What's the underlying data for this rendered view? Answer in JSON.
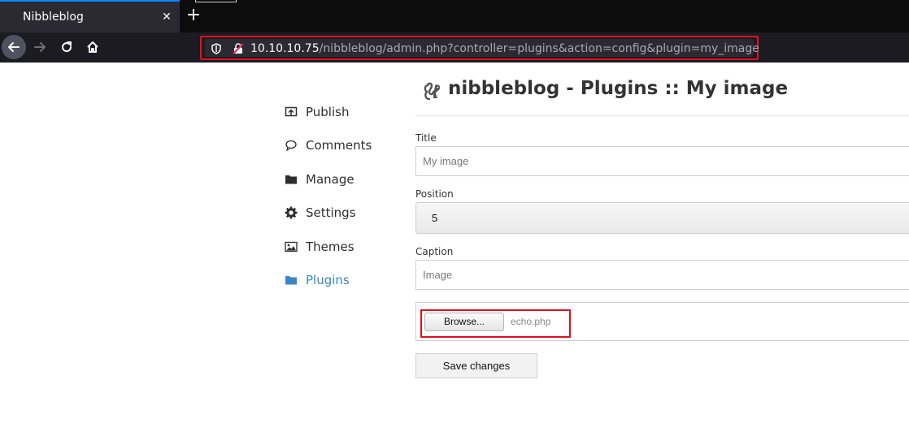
{
  "browser": {
    "tab_title": "Nibbleblog",
    "tab_close": "✕",
    "new_tab": "+",
    "url_host": "10.10.10.75",
    "url_path": "/nibbleblog/admin.php?controller=plugins&action=config&plugin=my_image"
  },
  "sidebar": {
    "items": [
      {
        "label": "Publish",
        "icon": "publish-icon"
      },
      {
        "label": "Comments",
        "icon": "comment-icon"
      },
      {
        "label": "Manage",
        "icon": "folder-icon"
      },
      {
        "label": "Settings",
        "icon": "gear-icon"
      },
      {
        "label": "Themes",
        "icon": "image-icon"
      },
      {
        "label": "Plugins",
        "icon": "folder-icon",
        "active": true
      }
    ]
  },
  "page": {
    "title": "nibbleblog - Plugins :: My image"
  },
  "form": {
    "title_label": "Title",
    "title_value": "My image",
    "position_label": "Position",
    "position_value": "5",
    "caption_label": "Caption",
    "caption_value": "Image",
    "browse_label": "Browse...",
    "file_name": "echo.php",
    "save_label": "Save changes"
  },
  "colors": {
    "accent": "#3a87c8",
    "highlight": "#e0111c",
    "tab_indicator": "#0a84ff"
  }
}
